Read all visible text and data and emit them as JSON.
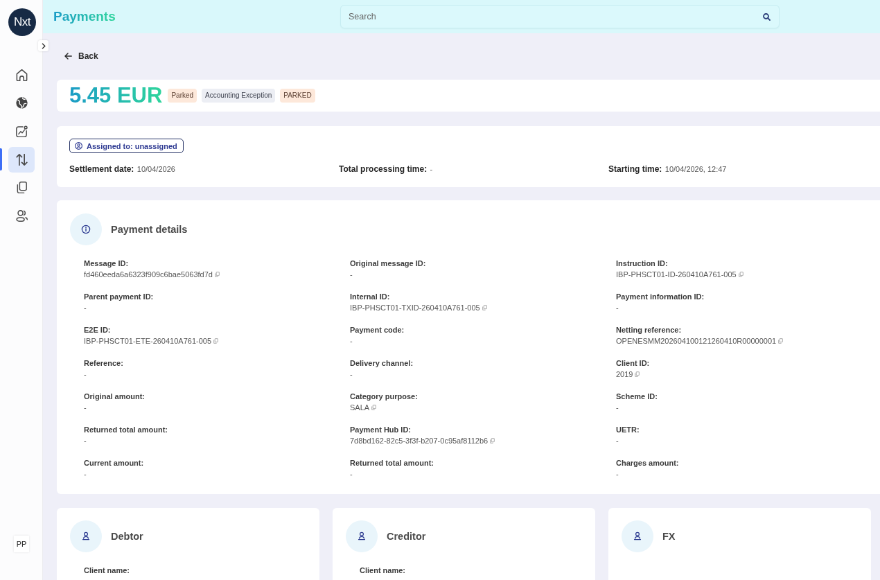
{
  "sidebar": {
    "logo": "Nxt",
    "items": [
      {
        "kind": "home",
        "selected": false
      },
      {
        "kind": "globe",
        "selected": false
      },
      {
        "kind": "chart",
        "selected": false
      },
      {
        "kind": "transfer",
        "selected": true
      },
      {
        "kind": "documents",
        "selected": false
      },
      {
        "kind": "users",
        "selected": false
      }
    ],
    "user_initials": "PP"
  },
  "header": {
    "title": "Payments",
    "search": {
      "placeholder": "Search"
    }
  },
  "back_link": "Back",
  "amount": {
    "value": "5.45 EUR",
    "badges": [
      {
        "label": "Parked",
        "kind": "warning"
      },
      {
        "label": "Accounting Exception",
        "kind": "neutral"
      },
      {
        "label": "PARKED",
        "kind": "warning"
      }
    ]
  },
  "summary": {
    "assignee_button": "Assigned to: unassigned",
    "items": [
      {
        "label": "Settlement date:",
        "value": "10/04/2026"
      },
      {
        "label": "Total processing time:",
        "value": "-"
      },
      {
        "label": "Starting time:",
        "value": "10/04/2026, 12:47"
      }
    ]
  },
  "payment_details": {
    "title": "Payment details",
    "fields": [
      {
        "label": "Message ID:",
        "value": "fd460eeda6a6323f909c6bae5063fd7d",
        "copyable": true
      },
      {
        "label": "Original message ID:",
        "value": "-",
        "copyable": false
      },
      {
        "label": "Instruction ID:",
        "value": "IBP-PHSCT01-ID-260410A761-005",
        "copyable": true
      },
      {
        "label": "Parent payment ID:",
        "value": "-",
        "copyable": false
      },
      {
        "label": "Internal ID:",
        "value": "IBP-PHSCT01-TXID-260410A761-005",
        "copyable": true
      },
      {
        "label": "Payment information ID:",
        "value": "-",
        "copyable": false
      },
      {
        "label": "E2E ID:",
        "value": "IBP-PHSCT01-ETE-260410A761-005",
        "copyable": true
      },
      {
        "label": "Payment code:",
        "value": "-",
        "copyable": false
      },
      {
        "label": "Netting reference:",
        "value": "OPENESMM202604100121260410R00000001",
        "copyable": true
      },
      {
        "label": "Reference:",
        "value": "-",
        "copyable": false
      },
      {
        "label": "Delivery channel:",
        "value": "-",
        "copyable": false
      },
      {
        "label": "Client ID:",
        "value": "2019",
        "copyable": true
      },
      {
        "label": "Original amount:",
        "value": "-",
        "copyable": false
      },
      {
        "label": "Category purpose:",
        "value": "SALA",
        "copyable": true
      },
      {
        "label": "Scheme ID:",
        "value": "-",
        "copyable": false
      },
      {
        "label": "Returned total amount:",
        "value": "-",
        "copyable": false
      },
      {
        "label": "Payment Hub ID:",
        "value": "7d8bd162-82c5-3f3f-b207-0c95af8112b6",
        "copyable": true
      },
      {
        "label": "UETR:",
        "value": "-",
        "copyable": false
      },
      {
        "label": "Current amount:",
        "value": "-",
        "copyable": false
      },
      {
        "label": "Returned total amount:",
        "value": "-",
        "copyable": false
      },
      {
        "label": "Charges amount:",
        "value": "-",
        "copyable": false
      }
    ]
  },
  "parties": [
    {
      "title": "Debtor",
      "fields": [
        {
          "label": "Client name:"
        }
      ]
    },
    {
      "title": "Creditor",
      "fields": [
        {
          "label": "Client name:"
        }
      ]
    },
    {
      "title": "FX"
    }
  ]
}
